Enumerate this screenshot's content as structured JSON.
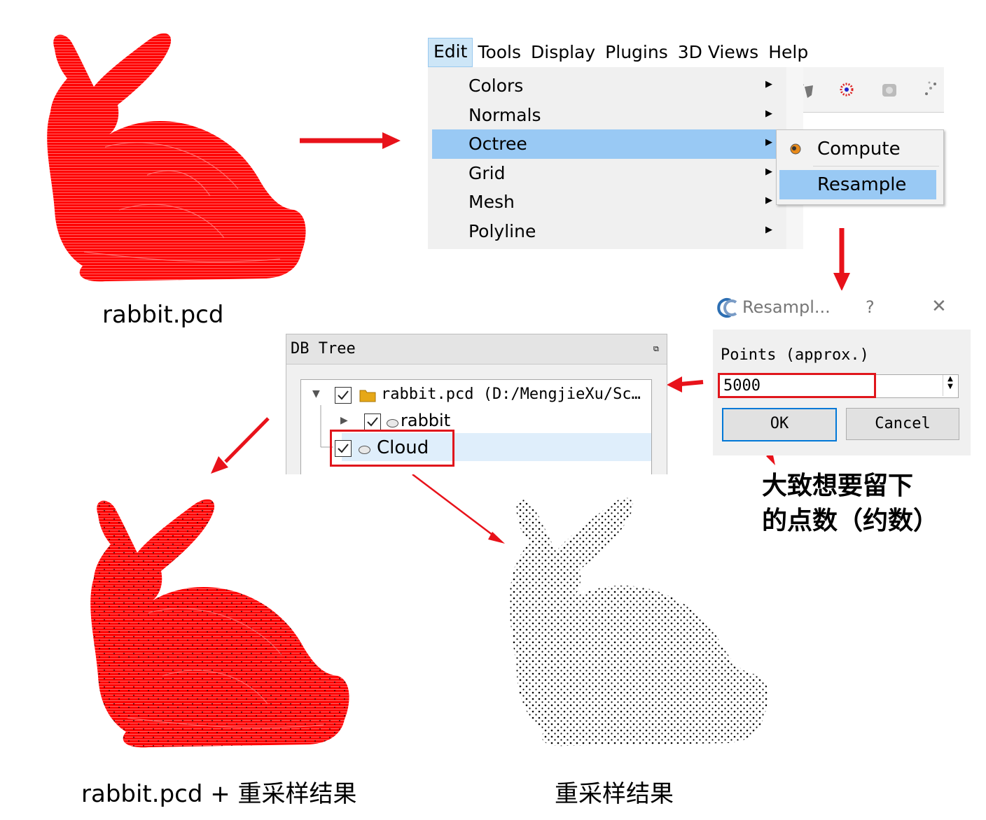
{
  "captions": {
    "original": "rabbit.pcd",
    "combined": "rabbit.pcd + 重采样结果",
    "result": "重采样结果"
  },
  "menubar": {
    "items": [
      "Edit",
      "Tools",
      "Display",
      "Plugins",
      "3D Views",
      "Help"
    ],
    "active": "Edit"
  },
  "edit_menu": {
    "items": [
      "Colors",
      "Normals",
      "Octree",
      "Grid",
      "Mesh",
      "Polyline"
    ],
    "highlighted": "Octree"
  },
  "octree_submenu": {
    "items": [
      "Compute",
      "Resample"
    ],
    "highlighted": "Resample"
  },
  "resample_dialog": {
    "title": "Resampl...",
    "help": "?",
    "close": "✕",
    "points_label": "Points (approx.)",
    "points_value": "5000",
    "ok_label": "OK",
    "cancel_label": "Cancel"
  },
  "annotation": {
    "line1": "大致想要留下",
    "line2": "的点数（约数）"
  },
  "db_tree": {
    "title": "DB Tree",
    "rows": [
      {
        "label": "rabbit.pcd (D:/MengjieXu/Sc…",
        "expanded": true,
        "checked": true
      },
      {
        "label": "rabbit",
        "expanded": false,
        "checked": true
      },
      {
        "label": "Cloud",
        "checked": true,
        "selected": true
      }
    ]
  },
  "colors": {
    "point_cloud_red": "#ff0000",
    "resampled_points": "#000000",
    "arrow": "#e8121a",
    "menu_highlight": "#99c9f4"
  }
}
